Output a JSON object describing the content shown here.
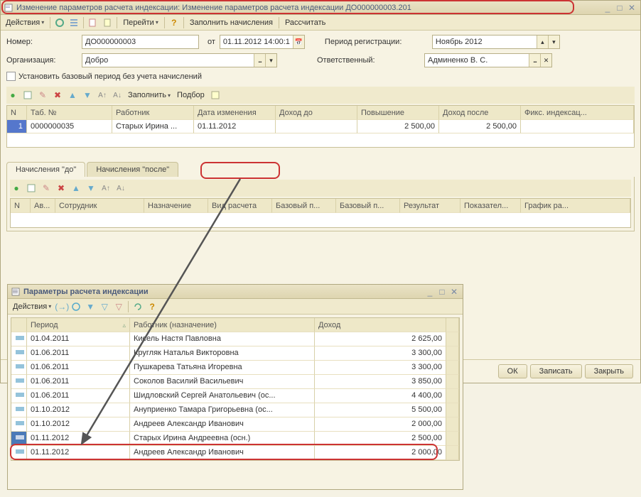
{
  "main_window": {
    "title": "Изменение параметров расчета индексации: Изменение параметров расчета индексации ДО000000003.201",
    "toolbar": {
      "actions": "Действия",
      "go": "Перейти",
      "fill": "Заполнить начисления",
      "calc": "Рассчитать"
    },
    "form": {
      "number_label": "Номер:",
      "number_value": "ДО000000003",
      "from_label": "от",
      "date_value": "01.11.2012 14:00:1",
      "period_label": "Период регистрации:",
      "period_value": "Ноябрь 2012",
      "org_label": "Организация:",
      "org_value": "Добро",
      "resp_label": "Ответственный:",
      "resp_value": "Админенко В. С.",
      "checkbox_label": "Установить базовый период без учета начислений"
    },
    "row_toolbar": {
      "fill": "Заполнить",
      "selection": "Подбор"
    },
    "table1": {
      "headers": {
        "n": "N",
        "tab": "Таб. №",
        "worker": "Работник",
        "date": "Дата изменения",
        "income_before": "Доход до",
        "increase": "Повышение",
        "income_after": "Доход после",
        "fixed": "Фикс. индексац..."
      },
      "row": {
        "n": "1",
        "tab": "0000000035",
        "worker": "Старых Ирина ...",
        "date": "01.11.2012",
        "income_before": "",
        "increase": "2 500,00",
        "income_after": "2 500,00",
        "fixed": ""
      }
    },
    "tabs": {
      "before": "Начисления \"до\"",
      "after": "Начисления \"после\""
    },
    "table2": {
      "headers": {
        "n": "N",
        "av": "Ав...",
        "emp": "Сотрудник",
        "assign": "Назначение",
        "calc_type": "Вид расчета",
        "base1": "Базовый п...",
        "base2": "Базовый п...",
        "result": "Результат",
        "indic": "Показател...",
        "schedule": "График ра..."
      }
    },
    "footer": {
      "ok": "ОК",
      "save": "Записать",
      "close": "Закрыть"
    }
  },
  "popup_window": {
    "title": "Параметры расчета индексации",
    "toolbar": {
      "actions": "Действия"
    },
    "table": {
      "headers": {
        "period": "Период",
        "worker": "Работник (назначение)",
        "income": "Доход"
      },
      "rows": [
        {
          "period": "01.04.2011",
          "worker": "Кисель Настя Павловна",
          "income": "2 625,00"
        },
        {
          "period": "01.06.2011",
          "worker": "Кругляк Наталья Викторовна",
          "income": "3 300,00"
        },
        {
          "period": "01.06.2011",
          "worker": "Пушкарева Татьяна Игоревна",
          "income": "3 300,00"
        },
        {
          "period": "01.06.2011",
          "worker": "Соколов Василий Васильевич",
          "income": "3 850,00"
        },
        {
          "period": "01.06.2011",
          "worker": "Шидловский Сергей Анатольевич (ос...",
          "income": "4 400,00"
        },
        {
          "period": "01.10.2012",
          "worker": "Ануприенко Тамара Григорьевна (ос...",
          "income": "5 500,00"
        },
        {
          "period": "01.10.2012",
          "worker": "Андреев Александр Иванович",
          "income": "2 000,00"
        },
        {
          "period": "01.11.2012",
          "worker": "Старых Ирина Андреевна (осн.)",
          "income": "2 500,00"
        },
        {
          "period": "01.11.2012",
          "worker": "Андреев Александр Иванович",
          "income": "2 000,00"
        }
      ]
    }
  },
  "icons": {
    "add": "➕",
    "edit": "✎",
    "del": "✖",
    "help": "?",
    "cal": "📅"
  }
}
